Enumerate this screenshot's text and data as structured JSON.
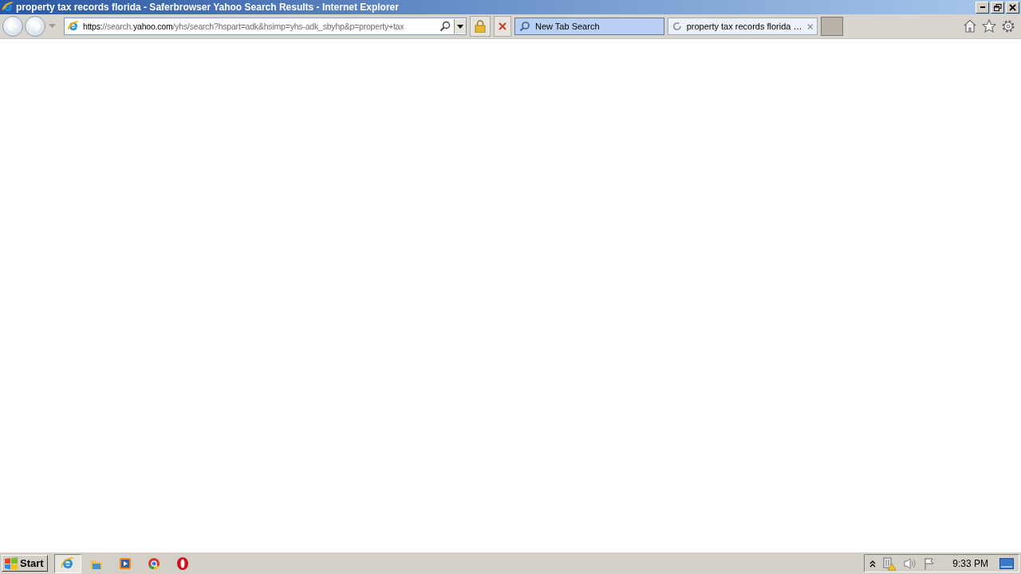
{
  "window": {
    "title": "property tax records florida - Saferbrowser Yahoo Search Results - Internet Explorer"
  },
  "address_bar": {
    "url_parts": [
      {
        "text": "https:",
        "highlight": true
      },
      {
        "text": "//search.",
        "highlight": false
      },
      {
        "text": "yahoo.com",
        "highlight": true
      },
      {
        "text": "/yhs/search?hspart=adk&hsimp=yhs-adk_sbyhp&p=property+tax",
        "highlight": false
      }
    ]
  },
  "tabs": [
    {
      "label": "New Tab Search",
      "selected": false,
      "kind": "search"
    },
    {
      "label": "property tax records florida …",
      "selected": true,
      "kind": "loading"
    }
  ],
  "taskbar": {
    "start": "Start",
    "apps": [
      {
        "kind": "ie",
        "selected": true
      },
      {
        "kind": "folder",
        "selected": false
      },
      {
        "kind": "media",
        "selected": false
      },
      {
        "kind": "chrome",
        "selected": false
      },
      {
        "kind": "opera",
        "selected": false
      }
    ],
    "clock": "9:33 PM"
  }
}
